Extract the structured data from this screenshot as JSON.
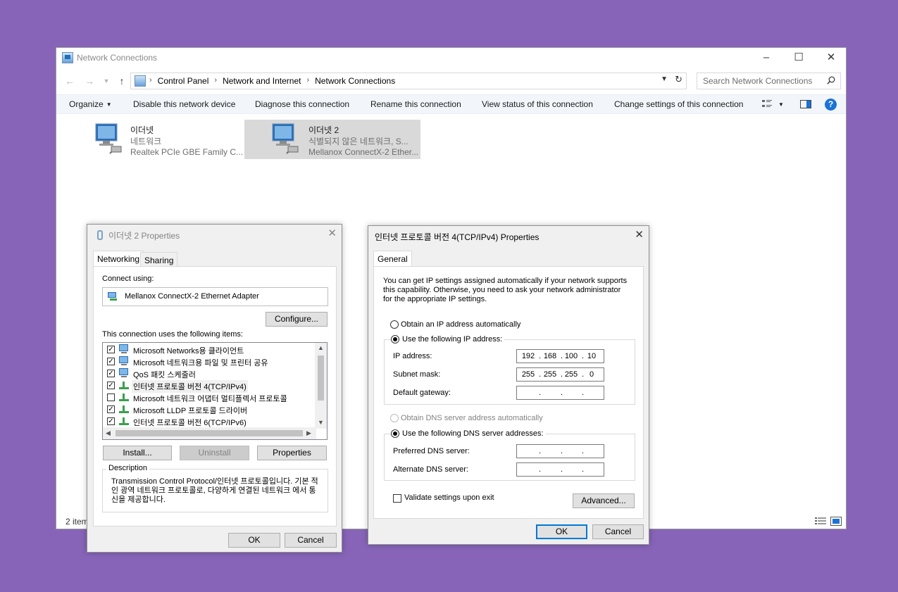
{
  "explorer": {
    "title": "Network Connections",
    "breadcrumbs": [
      "Control Panel",
      "Network and Internet",
      "Network Connections"
    ],
    "search_placeholder": "Search Network Connections",
    "commands": {
      "organize": "Organize",
      "disable": "Disable this network device",
      "diagnose": "Diagnose this connection",
      "rename": "Rename this connection",
      "view_status": "View status of this connection",
      "change_settings": "Change settings of this connection"
    },
    "connections": [
      {
        "name": "이더넷",
        "status": "네트워크",
        "device": "Realtek PCIe GBE Family C..."
      },
      {
        "name": "이더넷 2",
        "status": "식별되지 않은 네트워크, S...",
        "device": "Mellanox ConnectX-2 Ether..."
      }
    ],
    "status_count": "2 item"
  },
  "props": {
    "title": "이더넷 2 Properties",
    "tabs": [
      "Networking",
      "Sharing"
    ],
    "connect_using_label": "Connect using:",
    "adapter": "Mellanox ConnectX-2 Ethernet Adapter",
    "configure": "Configure...",
    "items_label": "This connection uses the following items:",
    "items": [
      {
        "checked": true,
        "label": "Microsoft Networks용 클라이언트"
      },
      {
        "checked": true,
        "label": "Microsoft 네트워크용 파일 및 프린터 공유"
      },
      {
        "checked": true,
        "label": "QoS 패킷 스케줄러"
      },
      {
        "checked": true,
        "label": "인터넷 프로토콜 버전 4(TCP/IPv4)"
      },
      {
        "checked": false,
        "label": "Microsoft 네트워크 어댑터 멀티플렉서 프로토콜"
      },
      {
        "checked": true,
        "label": "Microsoft LLDP 프로토콜 드라이버"
      },
      {
        "checked": true,
        "label": "인터넷 프로토콜 버전 6(TCP/IPv6)"
      }
    ],
    "install": "Install...",
    "uninstall": "Uninstall",
    "properties": "Properties",
    "description_label": "Description",
    "description": "Transmission Control Protocol/인터넷 프로토콜입니다. 기본 적인 광역 네트워크 프로토콜로, 다양하게 연결된 네트워크 에서 통신을 제공합니다.",
    "ok": "OK",
    "cancel": "Cancel"
  },
  "tcpip": {
    "title": "인터넷 프로토콜 버전 4(TCP/IPv4) Properties",
    "tab": "General",
    "info": "You can get IP settings assigned automatically if your network supports this capability. Otherwise, you need to ask your network administrator for the appropriate IP settings.",
    "obtain_ip_auto": "Obtain an IP address automatically",
    "use_following_ip": "Use the following IP address:",
    "ip_address_label": "IP address:",
    "ip_address": [
      "192",
      "168",
      "100",
      "10"
    ],
    "subnet_label": "Subnet mask:",
    "subnet": [
      "255",
      "255",
      "255",
      "0"
    ],
    "gateway_label": "Default gateway:",
    "obtain_dns_auto": "Obtain DNS server address automatically",
    "use_following_dns": "Use the following DNS server addresses:",
    "preferred_dns_label": "Preferred DNS server:",
    "alternate_dns_label": "Alternate DNS server:",
    "validate": "Validate settings upon exit",
    "advanced": "Advanced...",
    "ok": "OK",
    "cancel": "Cancel"
  }
}
